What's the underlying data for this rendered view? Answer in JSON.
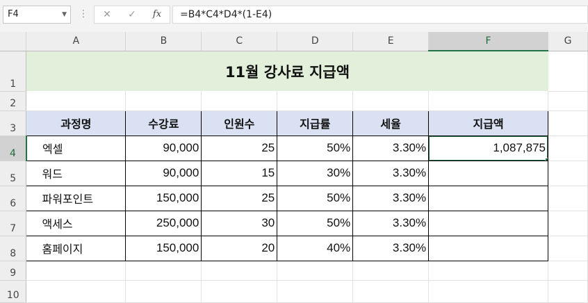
{
  "formula_bar": {
    "name_box": "F4",
    "formula": "=B4*C4*D4*(1-E4)",
    "cancel_icon": "✕",
    "enter_icon": "✓",
    "fx_label": "fx"
  },
  "columns": [
    "A",
    "B",
    "C",
    "D",
    "E",
    "F",
    "G"
  ],
  "rows": [
    "1",
    "2",
    "3",
    "4",
    "5",
    "6",
    "7",
    "8",
    "9",
    "10"
  ],
  "sheet": {
    "title": "11월 강사료 지급액",
    "headers": [
      "과정명",
      "수강료",
      "인원수",
      "지급률",
      "세율",
      "지급액"
    ],
    "data": [
      {
        "course": "엑셀",
        "fee": "90,000",
        "count": "25",
        "rate": "50%",
        "tax": "3.30%",
        "amount": "1,087,875"
      },
      {
        "course": "워드",
        "fee": "90,000",
        "count": "15",
        "rate": "30%",
        "tax": "3.30%",
        "amount": ""
      },
      {
        "course": "파워포인트",
        "fee": "150,000",
        "count": "25",
        "rate": "50%",
        "tax": "3.30%",
        "amount": ""
      },
      {
        "course": "액세스",
        "fee": "250,000",
        "count": "30",
        "rate": "50%",
        "tax": "3.30%",
        "amount": ""
      },
      {
        "course": "홈페이지",
        "fee": "150,000",
        "count": "20",
        "rate": "40%",
        "tax": "3.30%",
        "amount": ""
      }
    ]
  },
  "colors": {
    "title_fill": "#e2efda",
    "header_fill": "#d9e1f2",
    "selection": "#217346"
  }
}
